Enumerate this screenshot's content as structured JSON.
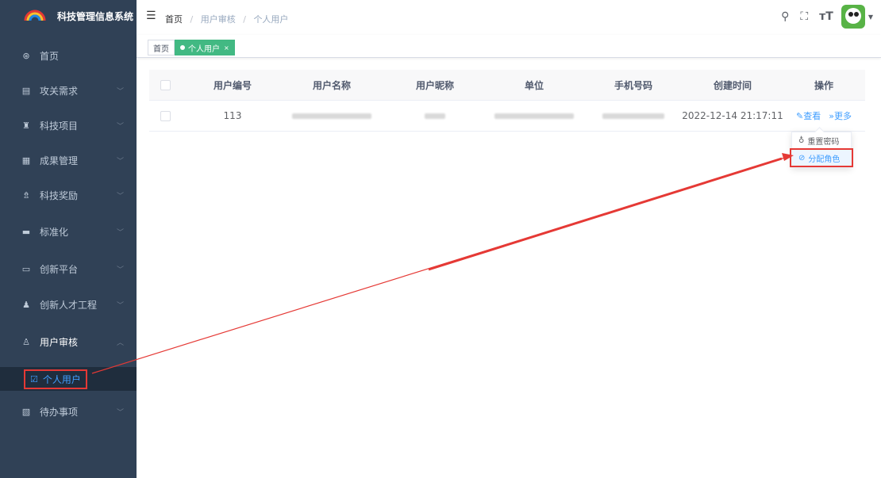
{
  "app": {
    "title": "科技管理信息系统",
    "logo_text": "Rainbow"
  },
  "sidebar": {
    "items": [
      {
        "label": "首页",
        "icon": "dashboard-icon",
        "glyph": "⊛"
      },
      {
        "label": "攻关需求",
        "icon": "list-icon",
        "glyph": "▤"
      },
      {
        "label": "科技项目",
        "icon": "project-icon",
        "glyph": "♜"
      },
      {
        "label": "成果管理",
        "icon": "result-icon",
        "glyph": "▦"
      },
      {
        "label": "科技奖励",
        "icon": "award-icon",
        "glyph": "⇯"
      },
      {
        "label": "标准化",
        "icon": "standard-icon",
        "glyph": "▬"
      },
      {
        "label": "创新平台",
        "icon": "monitor-icon",
        "glyph": "▭"
      },
      {
        "label": "创新人才工程",
        "icon": "people-icon",
        "glyph": "♟"
      },
      {
        "label": "用户审核",
        "icon": "user-audit-icon",
        "glyph": "♙"
      },
      {
        "label": "待办事项",
        "icon": "todo-icon",
        "glyph": "▧"
      }
    ],
    "sub_item": {
      "label": "个人用户",
      "icon": "checkbox-icon",
      "glyph": "☑"
    }
  },
  "header": {
    "breadcrumb": [
      "首页",
      "用户审核",
      "个人用户"
    ],
    "sep": "/"
  },
  "tags": [
    {
      "label": "首页"
    },
    {
      "label": "个人用户",
      "close": "×"
    }
  ],
  "table": {
    "columns": [
      "用户编号",
      "用户名称",
      "用户昵称",
      "单位",
      "手机号码",
      "创建时间",
      "操作"
    ],
    "rows": [
      {
        "id": "113",
        "created": "2022-12-14 21:17:11",
        "view": "查看",
        "more": "更多"
      }
    ]
  },
  "dropdown": {
    "items": [
      {
        "label": "重置密码",
        "glyph": "♁"
      },
      {
        "label": "分配角色",
        "glyph": "⊘"
      }
    ]
  },
  "colors": {
    "sidebar": "#304156",
    "accent": "#409eff",
    "tag_active": "#42b983",
    "highlight": "#e53935"
  }
}
